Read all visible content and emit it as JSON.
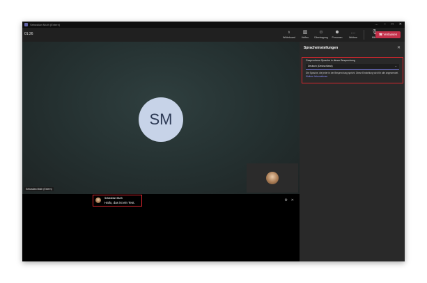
{
  "window": {
    "title": "Sebastian Muth (Extern)",
    "controls": [
      "…",
      "–",
      "□",
      "✕"
    ]
  },
  "toolbar": {
    "timer": "01:26",
    "tools": [
      {
        "name": "whiteboard-icon",
        "glyph": "♁",
        "label": "Whiteboard"
      },
      {
        "name": "layout-icon",
        "glyph": "▥",
        "label": "Heften"
      },
      {
        "name": "reactions-icon",
        "glyph": "☺",
        "label": "Übertragung"
      },
      {
        "name": "people-icon",
        "glyph": "☻",
        "label": "Personen"
      },
      {
        "name": "more-icon",
        "glyph": "…",
        "label": "Weitere"
      },
      {
        "name": "mic-icon",
        "glyph": "🎙",
        "label": "Mikro"
      }
    ],
    "leave_label": "Verlassen",
    "accent_leave": "#c4314b"
  },
  "stage": {
    "initials": "SM",
    "participant_name": "Sebastian Muth (Extern)"
  },
  "caption": {
    "speaker": "Sebastian Muth",
    "text": "Hallo, das ist ein Test.",
    "settings_glyph": "⚙",
    "close_glyph": "✕"
  },
  "panel": {
    "title": "Spracheinstellungen",
    "close_glyph": "✕",
    "spoken_language_label": "Gesprochene Sprache in dieser Besprechung",
    "selected_language": "Deutsch (Deutschland)",
    "description": "Die Sprache, die jeder in der Besprechung spricht. Diese Einstellung wird für alle angewendet.",
    "more_info_link": "Weitere Informationen",
    "highlight_color": "#d9262e"
  }
}
